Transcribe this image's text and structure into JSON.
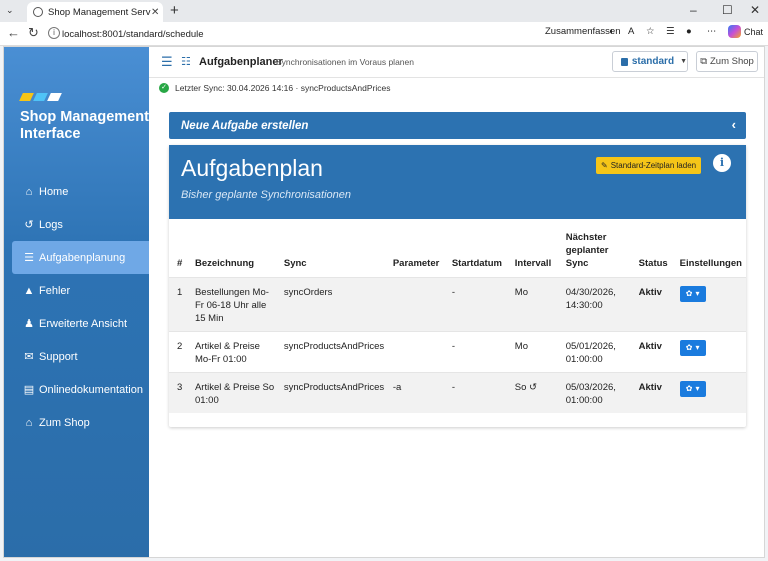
{
  "browser": {
    "tab_title": "Shop Management Service - neue",
    "url": "localhost:8001/standard/schedule",
    "zusammenfassen": "Zusammenfassen",
    "chat": "Chat",
    "new_tab": "+"
  },
  "sidebar": {
    "brand": "Shop Management Interface",
    "logo_colors": [
      "#f5c518",
      "#4fc3f7",
      "#ffffff"
    ],
    "items": [
      {
        "icon": "home-icon",
        "glyph": "⌂",
        "label": "Home"
      },
      {
        "icon": "history-icon",
        "glyph": "↺",
        "label": "Logs"
      },
      {
        "icon": "list-icon",
        "glyph": "☰",
        "label": "Aufgabenplanung",
        "active": true
      },
      {
        "icon": "warning-icon",
        "glyph": "▲",
        "label": "Fehler"
      },
      {
        "icon": "users-icon",
        "glyph": "♟",
        "label": "Erweiterte Ansicht"
      },
      {
        "icon": "envelope-icon",
        "glyph": "✉",
        "label": "Support"
      },
      {
        "icon": "book-icon",
        "glyph": "▤",
        "label": "Onlinedokumentation"
      },
      {
        "icon": "home-icon",
        "glyph": "⌂",
        "label": "Zum Shop"
      }
    ]
  },
  "topbar": {
    "title": "Aufgabenplaner",
    "subtitle": "Synchronisationen im Voraus planen",
    "store_select": "standard",
    "zum_shop": "Zum Shop"
  },
  "sync_status": "Letzter Sync: 30.04.2026 14:16 · syncProductsAndPrices",
  "new_task_panel": "Neue Aufgabe erstellen",
  "plan": {
    "title": "Aufgabenplan",
    "subtitle": "Bisher geplante Synchronisationen",
    "default_button": "Standard-Zeitplan laden",
    "columns": [
      "#",
      "Bezeichnung",
      "Sync",
      "Parameter",
      "Startdatum",
      "Intervall",
      "Nächster geplanter Sync",
      "Status",
      "Einstellungen"
    ],
    "rows": [
      {
        "num": "1",
        "name": "Bestellungen Mo-Fr 06-18 Uhr alle 15 Min",
        "sync": "syncOrders",
        "param": "",
        "start": "-",
        "interval": "Mo",
        "next": "04/30/2026, 14:30:00",
        "status": "Aktiv"
      },
      {
        "num": "2",
        "name": "Artikel & Preise Mo-Fr 01:00",
        "sync": "syncProductsAndPrices",
        "param": "",
        "start": "-",
        "interval": "Mo",
        "next": "05/01/2026, 01:00:00",
        "status": "Aktiv"
      },
      {
        "num": "3",
        "name": "Artikel & Preise So 01:00",
        "sync": "syncProductsAndPrices",
        "param": "-a",
        "start": "-",
        "interval": "So",
        "next": "05/03/2026, 01:00:00",
        "status": "Aktiv"
      }
    ]
  }
}
